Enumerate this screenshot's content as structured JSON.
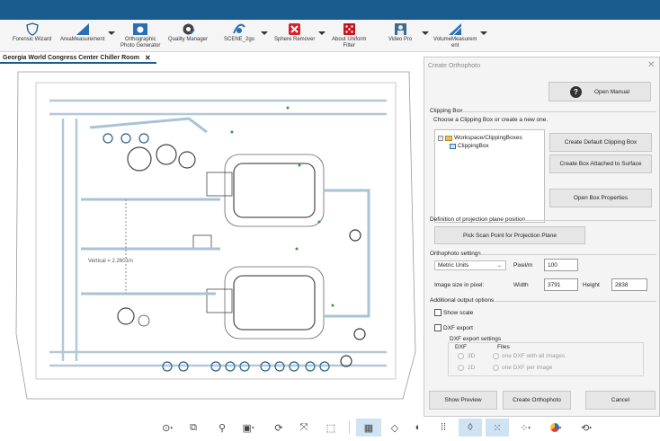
{
  "ribbon": {
    "items": [
      {
        "label": "Forensic Wizard",
        "icon": "shield-icon"
      },
      {
        "label": "AreaMeasurement",
        "icon": "area-icon"
      },
      {
        "label": "Orthographic\nPhoto Generator",
        "icon": "camera-icon"
      },
      {
        "label": "Quality Manager",
        "icon": "gear-check-icon"
      },
      {
        "label": "SCENE_2go",
        "icon": "scene-icon"
      },
      {
        "label": "Sphere Remover",
        "icon": "remove-icon"
      },
      {
        "label": "About Uniform\nFilter",
        "icon": "dice-icon"
      },
      {
        "label": "Video Pro",
        "icon": "person-icon"
      },
      {
        "label": "VolumeMeasurem\nent",
        "icon": "volume-icon"
      }
    ]
  },
  "doc_tab": {
    "label": "Georgia World Congress Center Chiller Room",
    "close": "✕"
  },
  "viewport": {
    "measurement_label": "Vertical = 2.2601m"
  },
  "dialog": {
    "title": "Create Orthophoto",
    "close": "✕",
    "open_manual": "Open Manual",
    "clipping": {
      "title": "Clipping Box",
      "subtitle": "Choose a Clipping Box or create a new one.",
      "tree": {
        "root": "Workspace/ClippingBoxes",
        "child": "ClippingBox"
      },
      "btn_default": "Create Default Clipping Box",
      "btn_attached": "Create Box Attached to Surface",
      "btn_props": "Open Box Properties"
    },
    "projection": {
      "title": "Definition of projection plane position",
      "btn_pick": "Pick Scan Point for Projection Plane"
    },
    "ortho": {
      "title": "Orthophoto settings",
      "units": "Metric Units",
      "pixel_label": "Pixel/m",
      "pixel_value": "100",
      "size_label": "Image size in pixel:",
      "width_label": "Width",
      "width_value": "3791",
      "height_label": "Height",
      "height_value": "2838"
    },
    "additional": {
      "title": "Additional output options",
      "show_scale": "Show scale",
      "dxf_export": "DXF export",
      "dxf_settings": "DXF export settings",
      "dxf_col": "DXF",
      "files_col": "Files",
      "opt_3d": "3D",
      "opt_2d": "2D",
      "opt_one": "one DXF with all images",
      "opt_per": "one DXF per image"
    },
    "footer": {
      "preview": "Show Preview",
      "create": "Create Orthophoto",
      "cancel": "Cancel"
    }
  },
  "colors": {
    "title_bar": "#1a5c8e",
    "accent_blue": "#2b6fb3",
    "active_toggle": "#cfe3f3"
  }
}
